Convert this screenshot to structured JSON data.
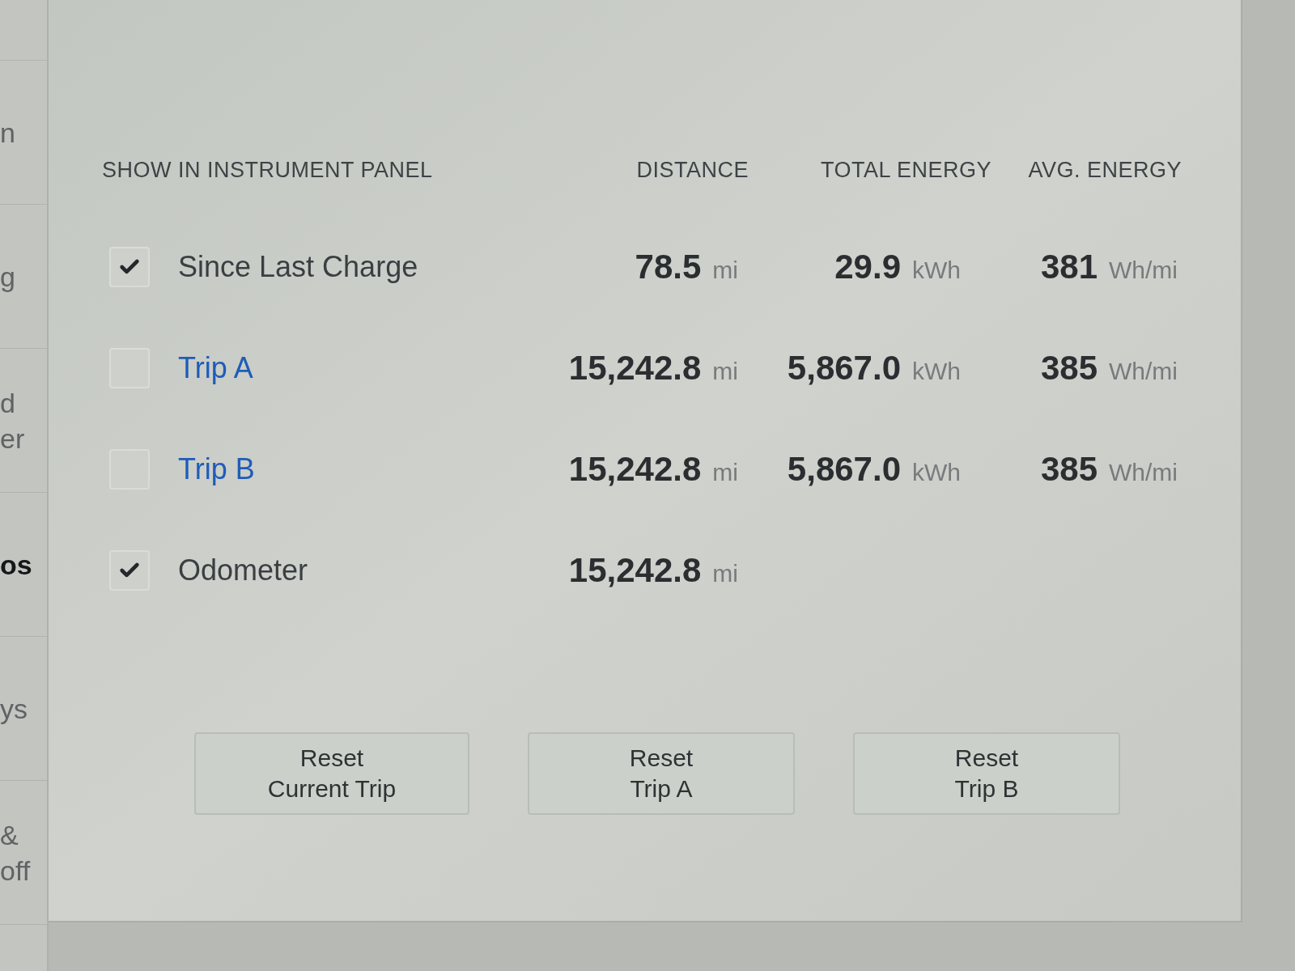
{
  "sidebar": {
    "items": [
      {
        "label": "n",
        "selected": false
      },
      {
        "label": "g",
        "selected": false
      },
      {
        "label": "d\ner",
        "selected": false
      },
      {
        "label": "os",
        "selected": true
      },
      {
        "label": "ys",
        "selected": false
      },
      {
        "label": "&\noff",
        "selected": false
      }
    ]
  },
  "table": {
    "columns": [
      "SHOW IN INSTRUMENT PANEL",
      "DISTANCE",
      "TOTAL ENERGY",
      "AVG. ENERGY"
    ],
    "rows": [
      {
        "label": "Since Last Charge",
        "checked": true,
        "color": "#3b3f42",
        "distance": {
          "value": "78.5",
          "unit": "mi"
        },
        "total_energy": {
          "value": "29.9",
          "unit": "kWh"
        },
        "avg_energy": {
          "value": "381",
          "unit": "Wh/mi"
        }
      },
      {
        "label": "Trip A",
        "checked": false,
        "color": "#1f5cb8",
        "distance": {
          "value": "15,242.8",
          "unit": "mi"
        },
        "total_energy": {
          "value": "5,867.0",
          "unit": "kWh"
        },
        "avg_energy": {
          "value": "385",
          "unit": "Wh/mi"
        }
      },
      {
        "label": "Trip B",
        "checked": false,
        "color": "#1f5cb8",
        "distance": {
          "value": "15,242.8",
          "unit": "mi"
        },
        "total_energy": {
          "value": "5,867.0",
          "unit": "kWh"
        },
        "avg_energy": {
          "value": "385",
          "unit": "Wh/mi"
        }
      },
      {
        "label": "Odometer",
        "checked": true,
        "color": "#3b3f42",
        "distance": {
          "value": "15,242.8",
          "unit": "mi"
        }
      }
    ]
  },
  "buttons": [
    "Reset\nCurrent Trip",
    "Reset\nTrip A",
    "Reset\nTrip B"
  ]
}
